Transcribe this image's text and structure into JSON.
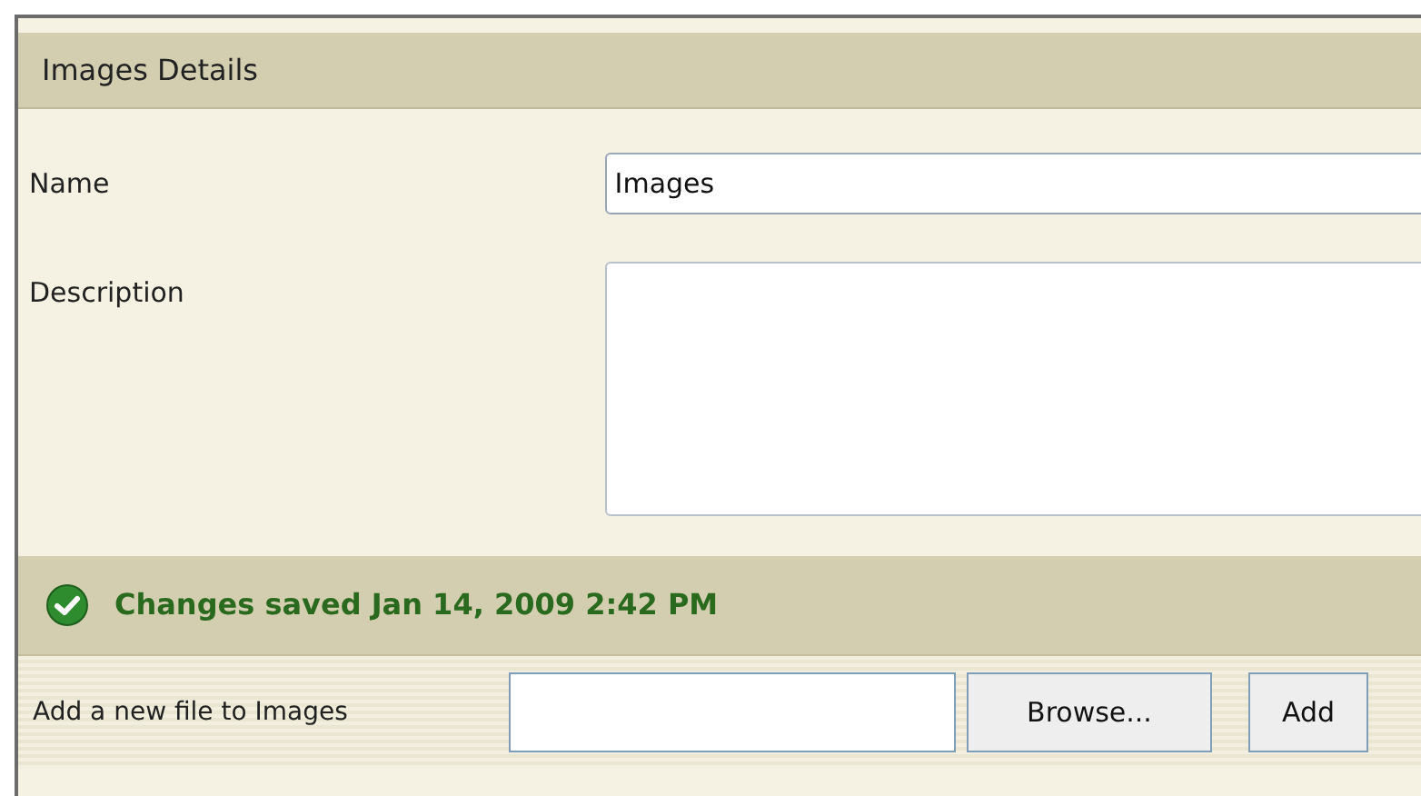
{
  "panel": {
    "title": "Images Details"
  },
  "fields": [
    {
      "label": "Name",
      "kind": "text",
      "value": "Images"
    },
    {
      "label": "Description",
      "kind": "textarea"
    }
  ],
  "status": {
    "message": "Changes saved Jan 14, 2009 2:42 PM"
  },
  "upload": {
    "label": "Add a new file to Images",
    "buttons": [
      "Browse...",
      "Add"
    ]
  }
}
